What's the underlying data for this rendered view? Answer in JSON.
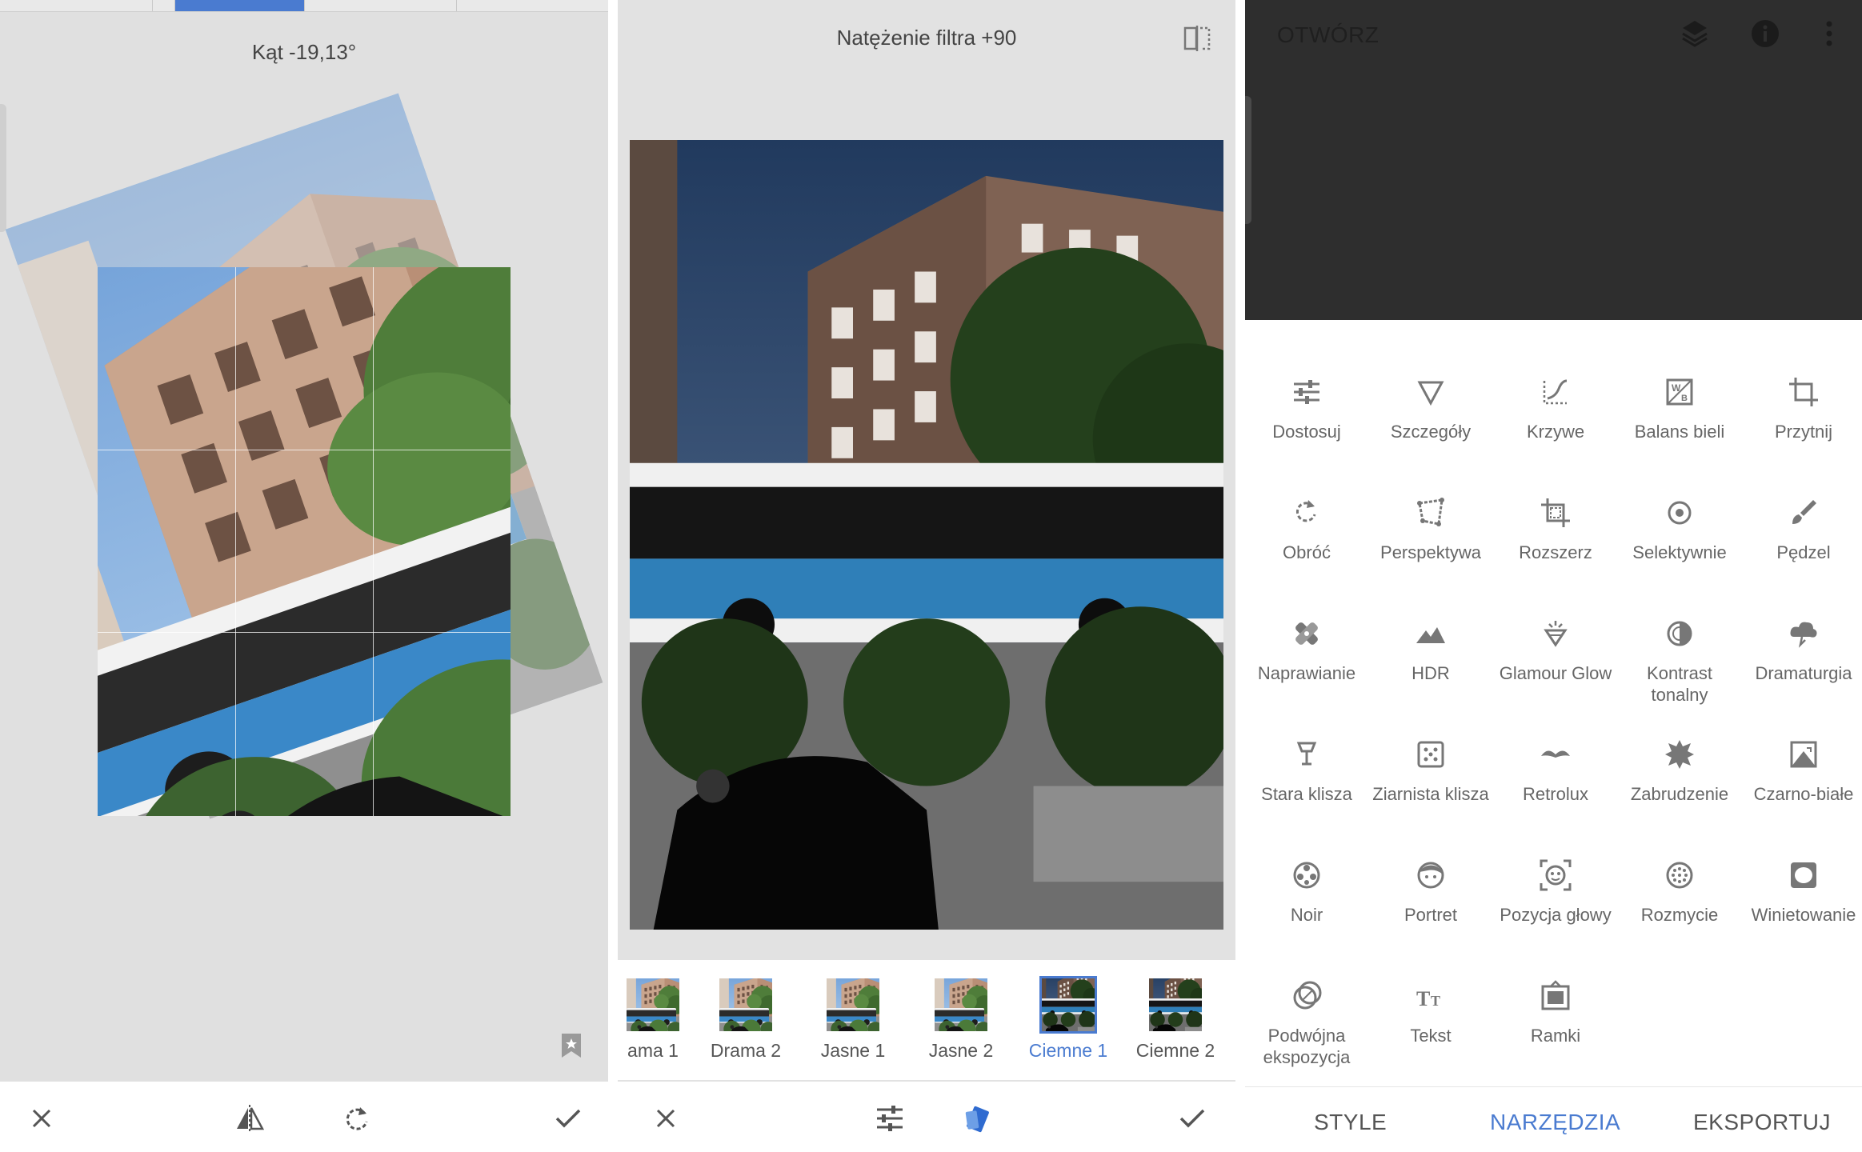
{
  "rotate_panel": {
    "angle_label": "Kąt -19,13°",
    "tabs_visible": 4,
    "active_tab": 1,
    "bottom": {
      "cancel_icon": "close-icon",
      "flip_icon": "flip-horizontal-icon",
      "rotate_icon": "rotate-icon",
      "apply_icon": "check-icon"
    }
  },
  "filter_panel": {
    "title": "Natężenie filtra +90",
    "filters": [
      {
        "label": "ama 1",
        "active": false
      },
      {
        "label": "Drama 2",
        "active": false
      },
      {
        "label": "Jasne 1",
        "active": false
      },
      {
        "label": "Jasne 2",
        "active": false
      },
      {
        "label": "Ciemne 1",
        "active": true
      },
      {
        "label": "Ciemne 2",
        "active": false
      }
    ],
    "bottom": {
      "cancel_icon": "close-icon",
      "adjust_icon": "sliders-icon",
      "style_icon": "style-picker-icon",
      "apply_icon": "check-icon"
    }
  },
  "tools_panel": {
    "open_label": "OTWÓRZ",
    "header_icons": [
      "layers-icon",
      "info-icon",
      "more-vertical-icon"
    ],
    "tools": [
      {
        "label": "Dostosuj",
        "icon": "tune"
      },
      {
        "label": "Szczegóły",
        "icon": "details"
      },
      {
        "label": "Krzywe",
        "icon": "curves"
      },
      {
        "label": "Balans bieli",
        "icon": "wb"
      },
      {
        "label": "Przytnij",
        "icon": "crop"
      },
      {
        "label": "Obróć",
        "icon": "rotate"
      },
      {
        "label": "Perspektywa",
        "icon": "perspective"
      },
      {
        "label": "Rozszerz",
        "icon": "expand"
      },
      {
        "label": "Selektywnie",
        "icon": "selective"
      },
      {
        "label": "Pędzel",
        "icon": "brush"
      },
      {
        "label": "Naprawianie",
        "icon": "healing"
      },
      {
        "label": "HDR",
        "icon": "hdr"
      },
      {
        "label": "Glamour Glow",
        "icon": "glow"
      },
      {
        "label": "Kontrast tonalny",
        "icon": "tonal"
      },
      {
        "label": "Dramaturgia",
        "icon": "drama"
      },
      {
        "label": "Stara klisza",
        "icon": "vintage"
      },
      {
        "label": "Ziarnista klisza",
        "icon": "grainy"
      },
      {
        "label": "Retrolux",
        "icon": "retrolux"
      },
      {
        "label": "Zabrudzenie",
        "icon": "grunge"
      },
      {
        "label": "Czarno-białe",
        "icon": "bw"
      },
      {
        "label": "Noir",
        "icon": "noir"
      },
      {
        "label": "Portret",
        "icon": "portrait"
      },
      {
        "label": "Pozycja głowy",
        "icon": "headpose"
      },
      {
        "label": "Rozmycie",
        "icon": "blur"
      },
      {
        "label": "Winietowanie",
        "icon": "vignette"
      },
      {
        "label": "Podwójna ekspozycja",
        "icon": "double"
      },
      {
        "label": "Tekst",
        "icon": "text"
      },
      {
        "label": "Ramki",
        "icon": "frames"
      }
    ],
    "nav": [
      {
        "label": "STYLE",
        "active": false
      },
      {
        "label": "NARZĘDZIA",
        "active": true
      },
      {
        "label": "EKSPORTUJ",
        "active": false
      }
    ]
  },
  "colors": {
    "accent": "#4a7bd0",
    "panel_gray": "#e0e0e0",
    "header_dark": "#2e2e2e"
  }
}
